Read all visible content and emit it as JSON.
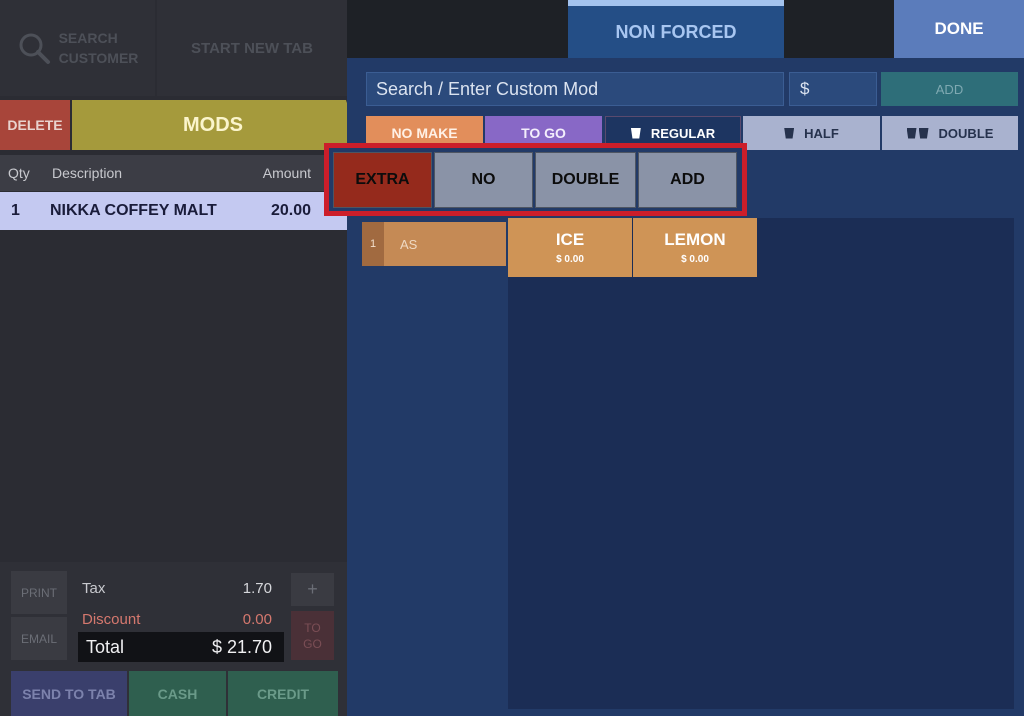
{
  "left": {
    "search_customer": "SEARCH\nCUSTOMER",
    "start_new_tab": "START NEW TAB",
    "delete": "DELETE",
    "mods": "MODS",
    "columns": {
      "qty": "Qty",
      "description": "Description",
      "amount": "Amount"
    },
    "order_items": [
      {
        "qty": "1",
        "description": "NIKKA COFFEY MALT",
        "amount": "20.00"
      }
    ],
    "print": "PRINT",
    "email": "EMAIL",
    "tax_label": "Tax",
    "tax_value": "1.70",
    "discount_label": "Discount",
    "discount_value": "0.00",
    "total_label": "Total",
    "total_value": "$ 21.70",
    "plus": "+",
    "to_go": "TO\nGO",
    "send_to_tab": "SEND TO TAB",
    "cash": "CASH",
    "credit": "CREDIT"
  },
  "right": {
    "tab_label": "NON FORCED",
    "done": "DONE",
    "search_placeholder": "Search / Enter Custom Mod",
    "dollar": "$",
    "add": "ADD",
    "mod_pills": [
      "NO MAKE",
      "TO GO"
    ],
    "sizes": [
      "REGULAR",
      "HALF",
      "DOUBLE"
    ],
    "options": [
      "EXTRA",
      "NO",
      "DOUBLE",
      "ADD"
    ],
    "item_number": "1",
    "item_code": "AS",
    "modifiers": [
      {
        "name": "ICE",
        "price": "$ 0.00"
      },
      {
        "name": "LEMON",
        "price": "$ 0.00"
      }
    ]
  },
  "colors": {
    "highlight_frame": "#cc1e2a",
    "extra_selected": "#952a1c",
    "modifier_item": "#cf9456",
    "mods_bar": "#a59a3c"
  }
}
